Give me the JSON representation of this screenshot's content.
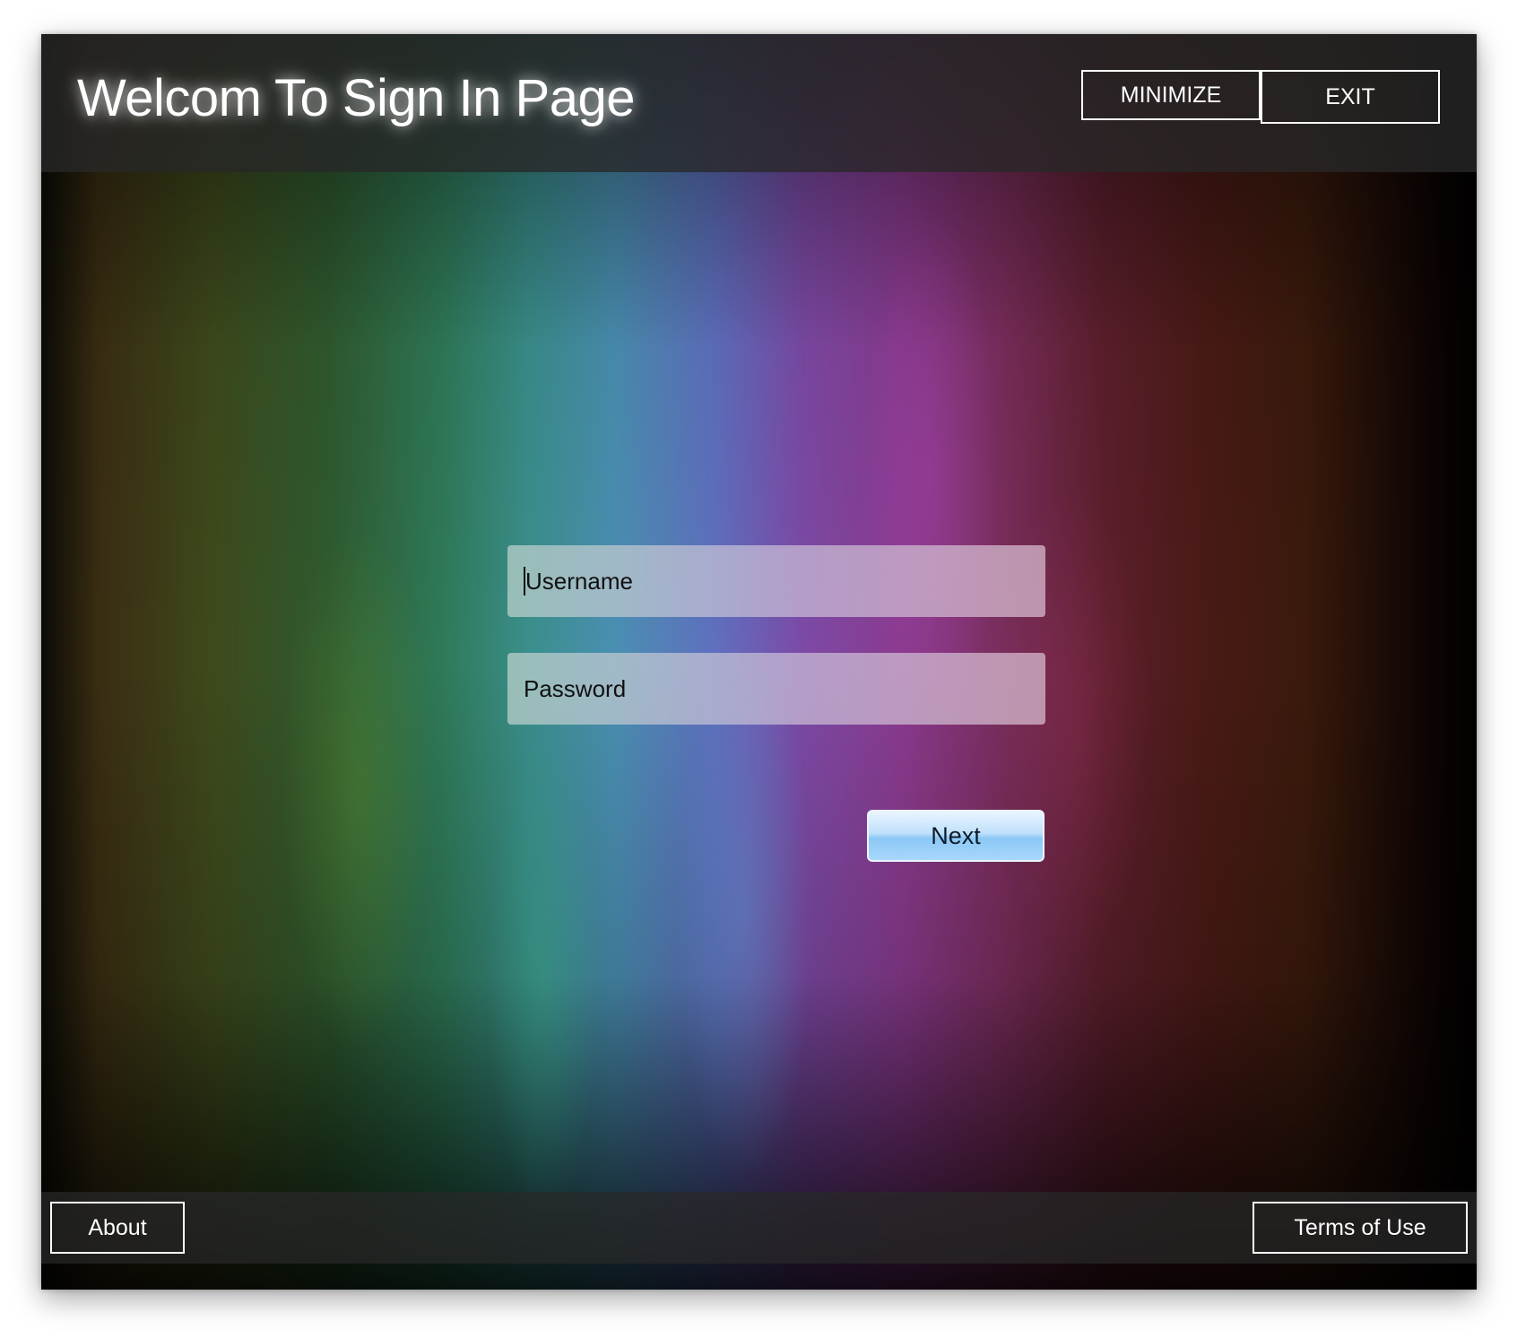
{
  "window": {
    "title": "Welcom To Sign In Page"
  },
  "header": {
    "minimize_label": "MINIMIZE",
    "exit_label": "EXIT"
  },
  "form": {
    "username_placeholder": "Username",
    "password_placeholder": "Password",
    "next_label": "Next"
  },
  "footer": {
    "about_label": "About",
    "terms_label": "Terms of Use"
  },
  "colors": {
    "header_bg": "#282828",
    "button_border": "#ffffff",
    "next_button": "#8cc8f6"
  }
}
